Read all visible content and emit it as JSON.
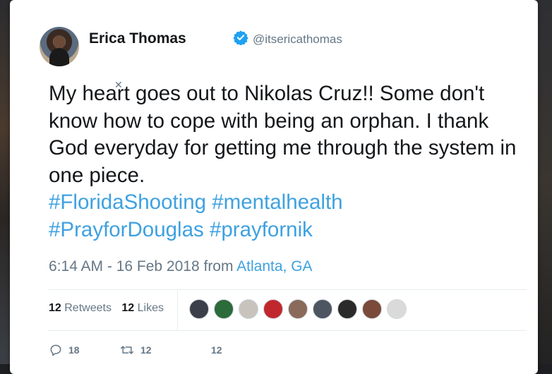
{
  "tweet": {
    "author_name": "Erica Thomas",
    "author_handle": "@itsericathomas",
    "text_main": "My heart goes out to Nikolas Cruz!! Some don't know how to cope with being an orphan. I thank God everyday for getting me through the system in one piece.",
    "hashtags": [
      "#FloridaShooting",
      "#mentalhealth",
      "#PrayforDouglas",
      "#prayfornik"
    ],
    "timestamp": "6:14 AM - 16 Feb 2018",
    "from_label": "from",
    "location": "Atlanta, GA"
  },
  "stats": {
    "retweets_count": "12",
    "retweets_label": "Retweets",
    "likes_count": "12",
    "likes_label": "Likes"
  },
  "actions": {
    "replies": "18",
    "retweets": "12",
    "likes": "12"
  },
  "colors": {
    "link": "#3ea1e0",
    "text": "#14171a",
    "muted": "#657786",
    "verified": "#1da1f2"
  },
  "liker_avatars": [
    {
      "name": "liker-avatar-1",
      "color": "#3b3f4a"
    },
    {
      "name": "liker-avatar-2",
      "color": "#2c6b3a"
    },
    {
      "name": "liker-avatar-3",
      "color": "#c9c3bd"
    },
    {
      "name": "liker-avatar-4",
      "color": "#c0282d"
    },
    {
      "name": "liker-avatar-5",
      "color": "#8a6a5a"
    },
    {
      "name": "liker-avatar-6",
      "color": "#4c5560"
    },
    {
      "name": "liker-avatar-7",
      "color": "#2a2a2a"
    },
    {
      "name": "liker-avatar-8",
      "color": "#7a4a3a"
    },
    {
      "name": "liker-avatar-9",
      "color": "#dadada"
    }
  ]
}
